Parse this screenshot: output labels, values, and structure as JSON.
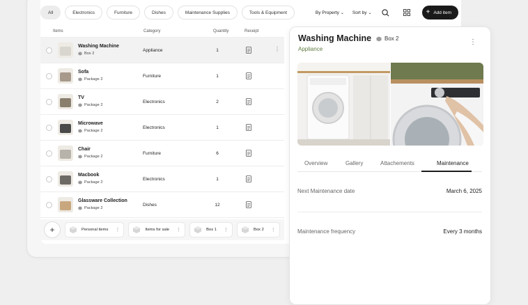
{
  "filters": {
    "chips": [
      "All",
      "Electronics",
      "Furniture",
      "Dishes",
      "Maintenance Supplies",
      "Tools & Equipment"
    ],
    "active_index": 0,
    "sort_by_property": "By Property",
    "sort_by": "Sort by",
    "add_item": "Add item"
  },
  "table": {
    "headers": {
      "items": "Items",
      "category": "Category",
      "quantity": "Quantity",
      "receipt": "Receipt"
    },
    "rows": [
      {
        "name": "Washing Machine",
        "box": "Box 2",
        "category": "Appliance",
        "quantity": "1",
        "thumb_color": "#d9d5cf"
      },
      {
        "name": "Sofa",
        "box": "Package 2",
        "category": "Furniture",
        "quantity": "1",
        "thumb_color": "#a89a8a"
      },
      {
        "name": "TV",
        "box": "Package 2",
        "category": "Electronics",
        "quantity": "2",
        "thumb_color": "#8a7f6d"
      },
      {
        "name": "Microwave",
        "box": "Package 2",
        "category": "Electronics",
        "quantity": "1",
        "thumb_color": "#4a4a4a"
      },
      {
        "name": "Chair",
        "box": "Package 2",
        "category": "Furniture",
        "quantity": "6",
        "thumb_color": "#b7b2aa"
      },
      {
        "name": "Macbook",
        "box": "Package 2",
        "category": "Electronics",
        "quantity": "1",
        "thumb_color": "#6d6a66"
      },
      {
        "name": "Glassware Collection",
        "box": "Package 2",
        "category": "Dishes",
        "quantity": "12",
        "thumb_color": "#c9a77e"
      }
    ]
  },
  "boxes": [
    "Personal items",
    "Items for sale",
    "Box 1",
    "Box 2"
  ],
  "detail": {
    "title": "Washing Machine",
    "box": "Box 2",
    "subtitle": "Appliance",
    "tabs": [
      "Overview",
      "Gallery",
      "Attachements",
      "Maintenance"
    ],
    "active_tab": "Maintenance",
    "fields": [
      {
        "label": "Next Maintenance date",
        "value": "March 6, 2025"
      },
      {
        "label": "Maintenance frequency",
        "value": "Every 3 months"
      }
    ]
  },
  "colors": {
    "accent_dark": "#1a1a1a",
    "subtitle_green": "#5e7a3e"
  }
}
